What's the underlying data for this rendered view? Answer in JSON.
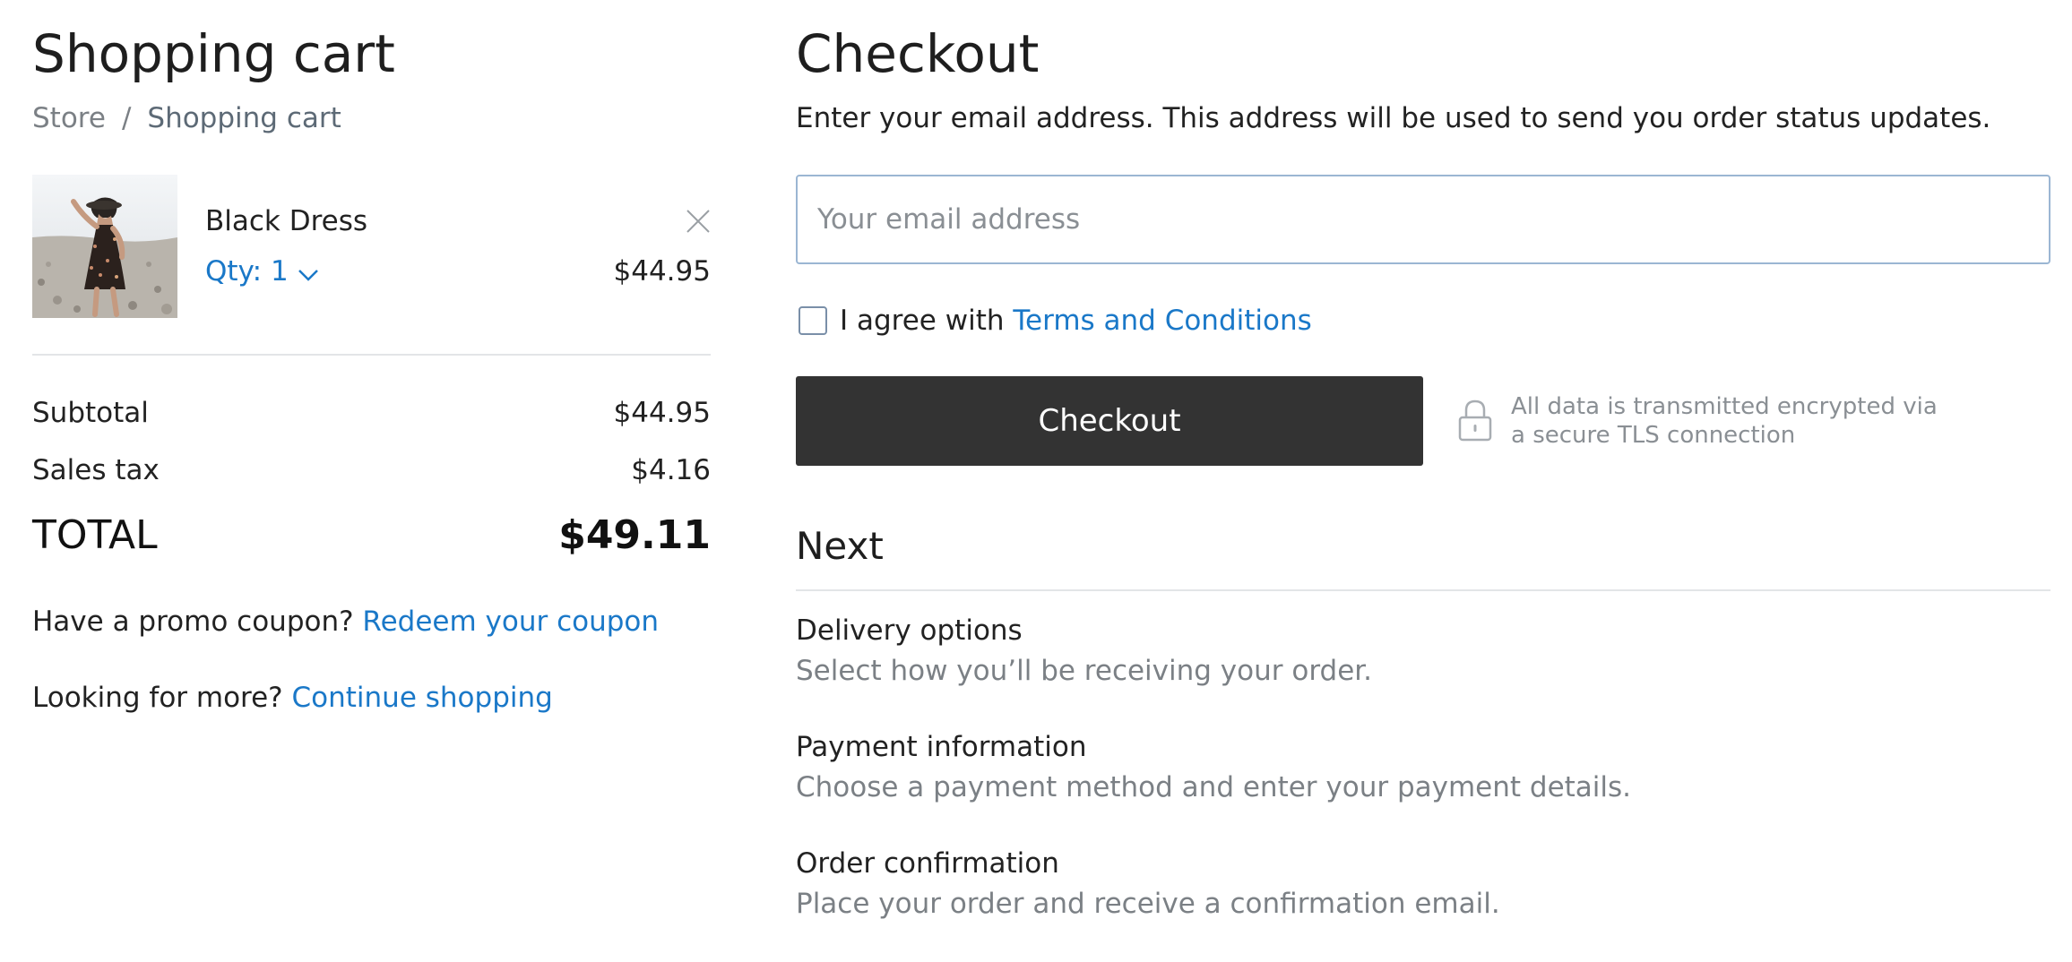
{
  "cart": {
    "title": "Shopping cart",
    "breadcrumb": {
      "store": "Store",
      "separator": "/",
      "current": "Shopping cart"
    },
    "items": [
      {
        "name": "Black Dress",
        "quantity_label": "Qty: 1",
        "price": "$44.95"
      }
    ],
    "summary": {
      "subtotal_label": "Subtotal",
      "subtotal_value": "$44.95",
      "tax_label": "Sales tax",
      "tax_value": "$4.16",
      "total_label": "TOTAL",
      "total_value": "$49.11"
    },
    "promo": {
      "prompt": "Have a promo coupon?",
      "link": "Redeem your coupon"
    },
    "more": {
      "prompt": "Looking for more?",
      "link": "Continue shopping"
    }
  },
  "checkout": {
    "title": "Checkout",
    "intro": "Enter your email address. This address will be used to send you order status updates.",
    "email": {
      "value": "",
      "placeholder": "Your email address"
    },
    "agree": {
      "prefix": "I agree with",
      "link": "Terms and Conditions",
      "checked": false
    },
    "button_label": "Checkout",
    "secure_note_line1": "All data is transmitted encrypted via",
    "secure_note_line2": "a secure TLS connection",
    "next": {
      "heading": "Next",
      "steps": [
        {
          "title": "Delivery options",
          "description": "Select how you’ll be receiving your order."
        },
        {
          "title": "Payment information",
          "description": "Choose a payment method and enter your payment details."
        },
        {
          "title": "Order confirmation",
          "description": "Place your order and receive a confirmation email."
        }
      ]
    }
  },
  "colors": {
    "link": "#1a78c8",
    "button": "#333333",
    "muted": "#7b8085"
  },
  "icons": {
    "remove": "close-icon",
    "qty": "chevron-down-icon",
    "lock": "lock-icon"
  }
}
